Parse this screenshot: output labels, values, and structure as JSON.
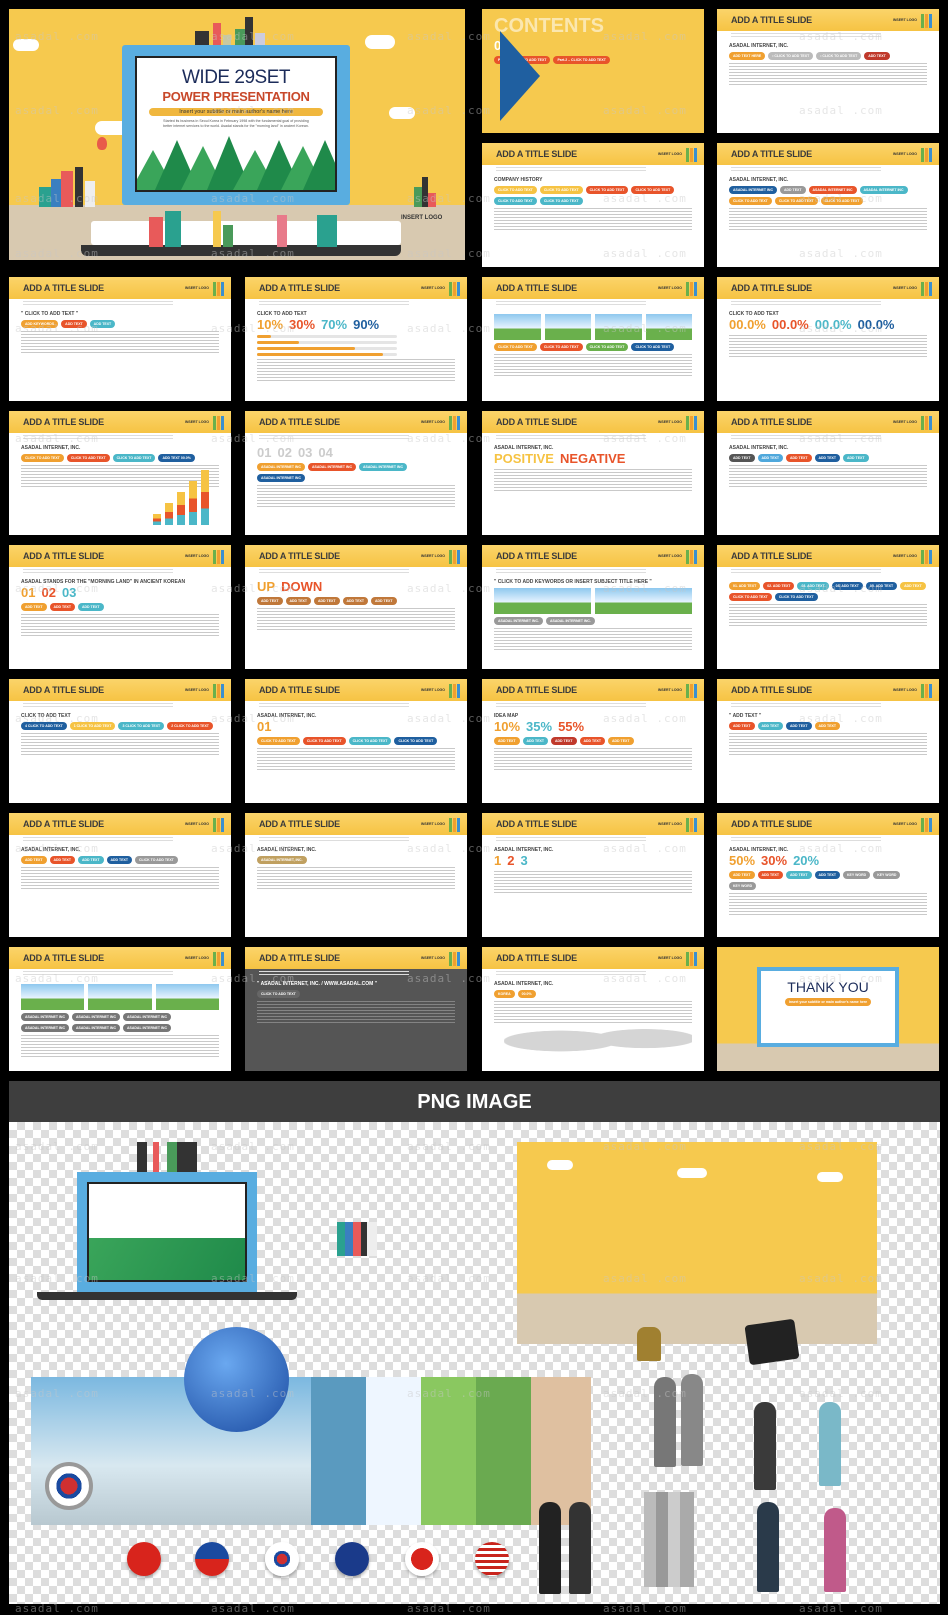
{
  "watermark": "asadal .com",
  "colors": {
    "yellow": "#f6c343",
    "blue": "#4fa8dc",
    "orange": "#e8542a",
    "navy": "#1f3f73",
    "teal": "#4bb7c8",
    "dark": "#444444"
  },
  "cover": {
    "title": "WIDE 29SET",
    "subtitle": "POWER PRESENTATION",
    "tagline": "Insert your subtitle or main author's name here",
    "description": "Started its business in Seoul Korea in February 1998 with the fundamental goal of providing better internet services to the world. Asadal stands for the \"morning land\" in ancient Korean.",
    "logo": "INSERT LOGO"
  },
  "slide_common": {
    "title": "ADD A TITLE SLIDE",
    "logo": "INSERT LOGO"
  },
  "slides": [
    {
      "variant": "contents",
      "col": 2,
      "row": 0,
      "heading": "CONTENTS",
      "chips": [
        "Part.1 – CLICK TO ADD TEXT",
        "Part.2 – CLICK TO ADD TEXT"
      ],
      "big": [
        {
          "text": "02",
          "color": "#ffffff"
        }
      ]
    },
    {
      "col": 3,
      "row": 0,
      "heading": "ASADAL INTERNET, INC.",
      "chips": [
        "ADD TEXT HERE",
        "• CLICK TO ADD TEXT",
        "• CLICK TO ADD TEXT",
        "ADD TEXT"
      ],
      "chipColors": [
        "#f0a030",
        "#bbbbbb",
        "#bbbbbb",
        "#c0392b"
      ]
    },
    {
      "col": 2,
      "row": 1,
      "heading": "COMPANY HISTORY",
      "chips": [
        "CLICK TO ADD TEXT",
        "CLICK TO ADD TEXT",
        "CLICK TO ADD TEXT",
        "CLICK TO ADD TEXT",
        "CLICK TO ADD TEXT",
        "CLICK TO ADD TEXT"
      ],
      "chipColors": [
        "#f6c343",
        "#f6c343",
        "#e8542a",
        "#e8542a",
        "#4bb7c8",
        "#4bb7c8"
      ]
    },
    {
      "col": 3,
      "row": 1,
      "heading": "ASADAL INTERNET, INC.",
      "chips": [
        "ASADAL INTERNET INC",
        "ADD TEXT",
        "ASADAL INTERNET INC",
        "ASADAL INTERNET INC",
        "CLICK TO ADD TEXT",
        "CLICK TO ADD TEXT",
        "CLICK TO ADD TEXT"
      ],
      "chipColors": [
        "#1f5f9f",
        "#999999",
        "#e8542a",
        "#4bb7c8",
        "#f0a030",
        "#f0a030",
        "#f0a030"
      ]
    },
    {
      "col": 0,
      "row": 2,
      "heading": "\" CLICK TO ADD TEXT \"",
      "chips": [
        "ADD KEYWORDS",
        "ADD TEXT",
        "ADD TEXT"
      ],
      "chipColors": [
        "#f0a030",
        "#e8542a",
        "#4bb7c8"
      ]
    },
    {
      "col": 1,
      "row": 2,
      "heading": "CLICK TO ADD TEXT",
      "big": [
        {
          "text": "10%",
          "color": "#f0a030"
        },
        {
          "text": "30%",
          "color": "#e8542a"
        },
        {
          "text": "70%",
          "color": "#4bb7c8"
        },
        {
          "text": "90%",
          "color": "#1f5f9f"
        }
      ],
      "progress": [
        10,
        30,
        70,
        90
      ]
    },
    {
      "col": 2,
      "row": 2,
      "heading": "",
      "chips": [
        "CLICK TO ADD TEXT",
        "CLICK TO ADD TEXT",
        "CLICK TO ADD TEXT",
        "CLICK TO ADD TEXT"
      ],
      "chipColors": [
        "#f0a030",
        "#e8542a",
        "#6ab04c",
        "#1f5f9f"
      ],
      "photos": 4
    },
    {
      "col": 3,
      "row": 2,
      "heading": "CLICK TO ADD TEXT",
      "big": [
        {
          "text": "00.0%",
          "color": "#f0a030"
        },
        {
          "text": "00.0%",
          "color": "#e8542a"
        },
        {
          "text": "00.0%",
          "color": "#4bb7c8"
        },
        {
          "text": "00.0%",
          "color": "#1f5f9f"
        }
      ]
    },
    {
      "col": 0,
      "row": 3,
      "heading": "ASADAL INTERNET, INC.",
      "chips": [
        "CLICK TO ADD TEXT",
        "CLICK TO ADD TEXT",
        "CLICK TO ADD TEXT",
        "ADD TEXT 00.0%"
      ],
      "chipColors": [
        "#f0a030",
        "#e8542a",
        "#4bb7c8",
        "#1f5f9f"
      ],
      "cols": [
        20,
        40,
        60,
        80,
        100
      ]
    },
    {
      "col": 1,
      "row": 3,
      "heading": "",
      "big": [
        {
          "text": "01",
          "color": "#cccccc"
        },
        {
          "text": "02",
          "color": "#cccccc"
        },
        {
          "text": "03",
          "color": "#cccccc"
        },
        {
          "text": "04",
          "color": "#cccccc"
        }
      ],
      "chips": [
        "ASADAL INTERNET INC",
        "ASADAL INTERNET INC",
        "ASADAL INTERNET INC",
        "ASADAL INTERNET INC"
      ],
      "chipColors": [
        "#f0a030",
        "#e8542a",
        "#4bb7c8",
        "#1f5f9f"
      ]
    },
    {
      "col": 2,
      "row": 3,
      "heading": "ASADAL INTERNET, INC.",
      "big": [
        {
          "text": "POSITIVE",
          "color": "#f6c343"
        },
        {
          "text": "NEGATIVE",
          "color": "#e8542a"
        }
      ]
    },
    {
      "col": 3,
      "row": 3,
      "heading": "ASADAL INTERNET, INC.",
      "chips": [
        "ADD TEXT",
        "ADD TEXT",
        "ADD TEXT",
        "ADD TEXT",
        "ADD TEXT"
      ],
      "chipColors": [
        "#555555",
        "#4fa8dc",
        "#e8542a",
        "#1f5f9f",
        "#4bb7c8"
      ]
    },
    {
      "col": 0,
      "row": 4,
      "heading": "ASADAL STANDS FOR THE \"MORNING LAND\" IN ANCIENT KOREAN",
      "big": [
        {
          "text": "01",
          "color": "#f0a030"
        },
        {
          "text": "02",
          "color": "#e8542a"
        },
        {
          "text": "03",
          "color": "#4bb7c8"
        }
      ],
      "chips": [
        "ADD TEXT",
        "ADD TEXT",
        "ADD TEXT"
      ],
      "chipColors": [
        "#f0a030",
        "#e8542a",
        "#4bb7c8"
      ]
    },
    {
      "col": 1,
      "row": 4,
      "heading": "",
      "big": [
        {
          "text": "UP",
          "color": "#f0a030"
        },
        {
          "text": "DOWN",
          "color": "#e8542a"
        }
      ],
      "chips": [
        "ADD TEXT",
        "ADD TEXT",
        "ADD TEXT",
        "ADD TEXT",
        "ADD TEXT"
      ],
      "chipColors": [
        "#c0783a",
        "#c0783a",
        "#c0783a",
        "#c0783a",
        "#c0783a"
      ]
    },
    {
      "col": 2,
      "row": 4,
      "heading": "\" CLICK TO ADD KEYWORDS OR INSERT SUBJECT TITLE HERE \"",
      "chips": [
        "ASADAL INTERNET INC.",
        "ASADAL INTERNET INC."
      ],
      "chipColors": [
        "#999999",
        "#999999"
      ],
      "photos": 2
    },
    {
      "col": 3,
      "row": 4,
      "heading": "",
      "chips": [
        "01. ADD TEXT",
        "02. ADD TEXT",
        "03. ADD TEXT",
        "04. ADD TEXT",
        "05. ADD TEXT",
        "ADD TEXT",
        "CLICK TO ADD TEXT",
        "CLICK TO ADD TEXT"
      ],
      "chipColors": [
        "#f0a030",
        "#e8542a",
        "#4bb7c8",
        "#1f5f9f",
        "#1f5f9f",
        "#f6c343",
        "#e8542a",
        "#1f5f9f"
      ],
      "table": true
    },
    {
      "col": 0,
      "row": 5,
      "heading": "CLICK TO ADD TEXT",
      "chips": [
        "4 CLICK TO ADD TEXT",
        "1 CLICK TO ADD TEXT",
        "3 CLICK TO ADD TEXT",
        "2 CLICK TO ADD TEXT"
      ],
      "chipColors": [
        "#1f5f9f",
        "#f6c343",
        "#4bb7c8",
        "#e8542a"
      ]
    },
    {
      "col": 1,
      "row": 5,
      "heading": "ASADAL INTERNET, INC.",
      "big": [
        {
          "text": "01",
          "color": "#f0a030"
        }
      ],
      "chips": [
        "CLICK TO ADD TEXT",
        "CLICK TO ADD TEXT",
        "CLICK TO ADD TEXT",
        "CLICK TO ADD TEXT"
      ],
      "chipColors": [
        "#f0a030",
        "#e8542a",
        "#4bb7c8",
        "#1f5f9f"
      ]
    },
    {
      "col": 2,
      "row": 5,
      "heading": "IDEA MAP",
      "big": [
        {
          "text": "10%",
          "color": "#f0a030"
        },
        {
          "text": "35%",
          "color": "#4bb7c8"
        },
        {
          "text": "55%",
          "color": "#e8542a"
        }
      ],
      "chips": [
        "ADD TEXT",
        "ADD TEXT",
        "ADD TEXT",
        "ADD TEXT",
        "ADD TEXT"
      ],
      "chipColors": [
        "#f0a030",
        "#4bb7c8",
        "#c0392b",
        "#e8542a",
        "#f0a030"
      ]
    },
    {
      "col": 3,
      "row": 5,
      "heading": "\" ADD TEXT \"",
      "chips": [
        "ADD TEXT",
        "ADD TEXT",
        "ADD TEXT",
        "ADD TEXT"
      ],
      "chipColors": [
        "#e8542a",
        "#4bb7c8",
        "#1f5f9f",
        "#f0a030"
      ]
    },
    {
      "col": 0,
      "row": 6,
      "heading": "ASADAL INTERNET, INC.",
      "chips": [
        "ADD TEXT",
        "ADD TEXT",
        "ADD TEXT",
        "ADD TEXT",
        "CLICK TO ADD TEXT"
      ],
      "chipColors": [
        "#f0a030",
        "#e8542a",
        "#4bb7c8",
        "#1f5f9f",
        "#999999"
      ]
    },
    {
      "col": 1,
      "row": 6,
      "heading": "ASADAL INTERNET, INC.",
      "chips": [
        "ASADAL INTERNET, INC."
      ],
      "chipColors": [
        "#c0a060"
      ]
    },
    {
      "col": 2,
      "row": 6,
      "heading": "ASADAL INTERNET, INC.",
      "big": [
        {
          "text": "1",
          "color": "#f0a030"
        },
        {
          "text": "2",
          "color": "#e8542a"
        },
        {
          "text": "3",
          "color": "#4bb7c8"
        }
      ]
    },
    {
      "col": 3,
      "row": 6,
      "heading": "ASADAL INTERNET, INC.",
      "big": [
        {
          "text": "50%",
          "color": "#f0a030"
        },
        {
          "text": "30%",
          "color": "#e8542a"
        },
        {
          "text": "20%",
          "color": "#4bb7c8"
        }
      ],
      "chips": [
        "ADD TEXT",
        "ADD TEXT",
        "ADD TEXT",
        "ADD TEXT",
        "KEY WORD",
        "KEY WORD",
        "KEY WORD"
      ],
      "chipColors": [
        "#f0a030",
        "#e8542a",
        "#4bb7c8",
        "#1f5f9f",
        "#999999",
        "#999999",
        "#999999"
      ]
    },
    {
      "col": 0,
      "row": 7,
      "heading": "",
      "chips": [
        "ASADAL INTERNET INC",
        "ASADAL INTERNET INC",
        "ASADAL INTERNET INC",
        "ASADAL INTERNET INC",
        "ASADAL INTERNET INC",
        "ASADAL INTERNET INC"
      ],
      "chipColors": [
        "#777777",
        "#777777",
        "#777777",
        "#777777",
        "#777777",
        "#777777"
      ],
      "photos": 3
    },
    {
      "variant": "dark",
      "col": 1,
      "row": 7,
      "heading": "\" ASADAL INTERNET, INC. / WWW.ASADAL.COM \"",
      "chips": [
        "CLICK TO ADD TEXT"
      ],
      "chipColors": [
        "#666666"
      ]
    },
    {
      "col": 2,
      "row": 7,
      "heading": "ASADAL INTERNET, INC.",
      "chips": [
        "KOREA",
        "00.0%"
      ],
      "chipColors": [
        "#f0a030",
        "#f0a030"
      ],
      "map": true
    },
    {
      "variant": "thanks",
      "col": 3,
      "row": 7,
      "heading": "THANK YOU",
      "chips": [
        "Insert your subtitle or main author's name here"
      ],
      "chipColors": [
        "#f0a030"
      ]
    }
  ],
  "png_section": {
    "title": "PNG IMAGE"
  }
}
